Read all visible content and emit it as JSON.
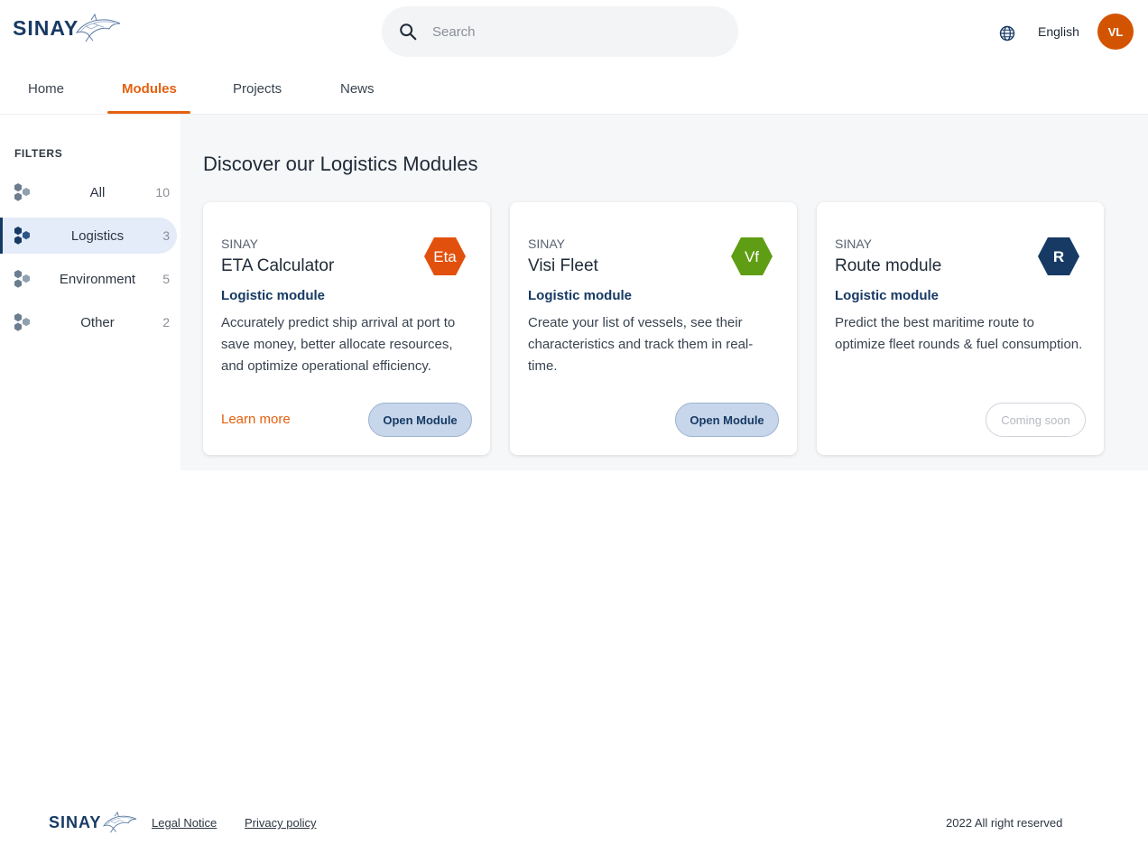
{
  "brand": {
    "name": "SINAY"
  },
  "header": {
    "search_placeholder": "Search",
    "language": "English",
    "avatar_initials": "VL"
  },
  "tabs": [
    {
      "label": "Home",
      "active": false
    },
    {
      "label": "Modules",
      "active": true
    },
    {
      "label": "Projects",
      "active": false
    },
    {
      "label": "News",
      "active": false
    }
  ],
  "sidebar": {
    "title": "FILTERS",
    "items": [
      {
        "label": "All",
        "count": "10",
        "active": false
      },
      {
        "label": "Logistics",
        "count": "3",
        "active": true
      },
      {
        "label": "Environment",
        "count": "5",
        "active": false
      },
      {
        "label": "Other",
        "count": "2",
        "active": false
      }
    ]
  },
  "main": {
    "title": "Discover our Logistics Modules",
    "cards": [
      {
        "vendor": "SINAY",
        "title": "ETA Calculator",
        "badge": "Eta",
        "badge_color": "#e2500e",
        "subtitle": "Logistic module",
        "description": "Accurately predict ship arrival at port to save money, better allocate resources, and optimize operational efficiency.",
        "learn_more": "Learn more",
        "button": "Open Module"
      },
      {
        "vendor": "SINAY",
        "title": "Visi Fleet",
        "badge": "Vf",
        "badge_color": "#5f9e14",
        "subtitle": "Logistic module",
        "description": "Create your list of vessels, see their characteristics and track them in real-time.",
        "button": "Open Module"
      },
      {
        "vendor": "SINAY",
        "title": "Route module",
        "badge": "R",
        "badge_color": "#173a64",
        "subtitle": "Logistic module",
        "description": "Predict the best maritime route to optimize fleet rounds & fuel consumption.",
        "button": "Coming soon"
      }
    ]
  },
  "footer": {
    "legal": "Legal Notice",
    "privacy": "Privacy policy",
    "copyright": "2022 All right reserved"
  },
  "colors": {
    "accent": "#e4610f",
    "brand_navy": "#173a64",
    "avatar": "#d35400"
  }
}
